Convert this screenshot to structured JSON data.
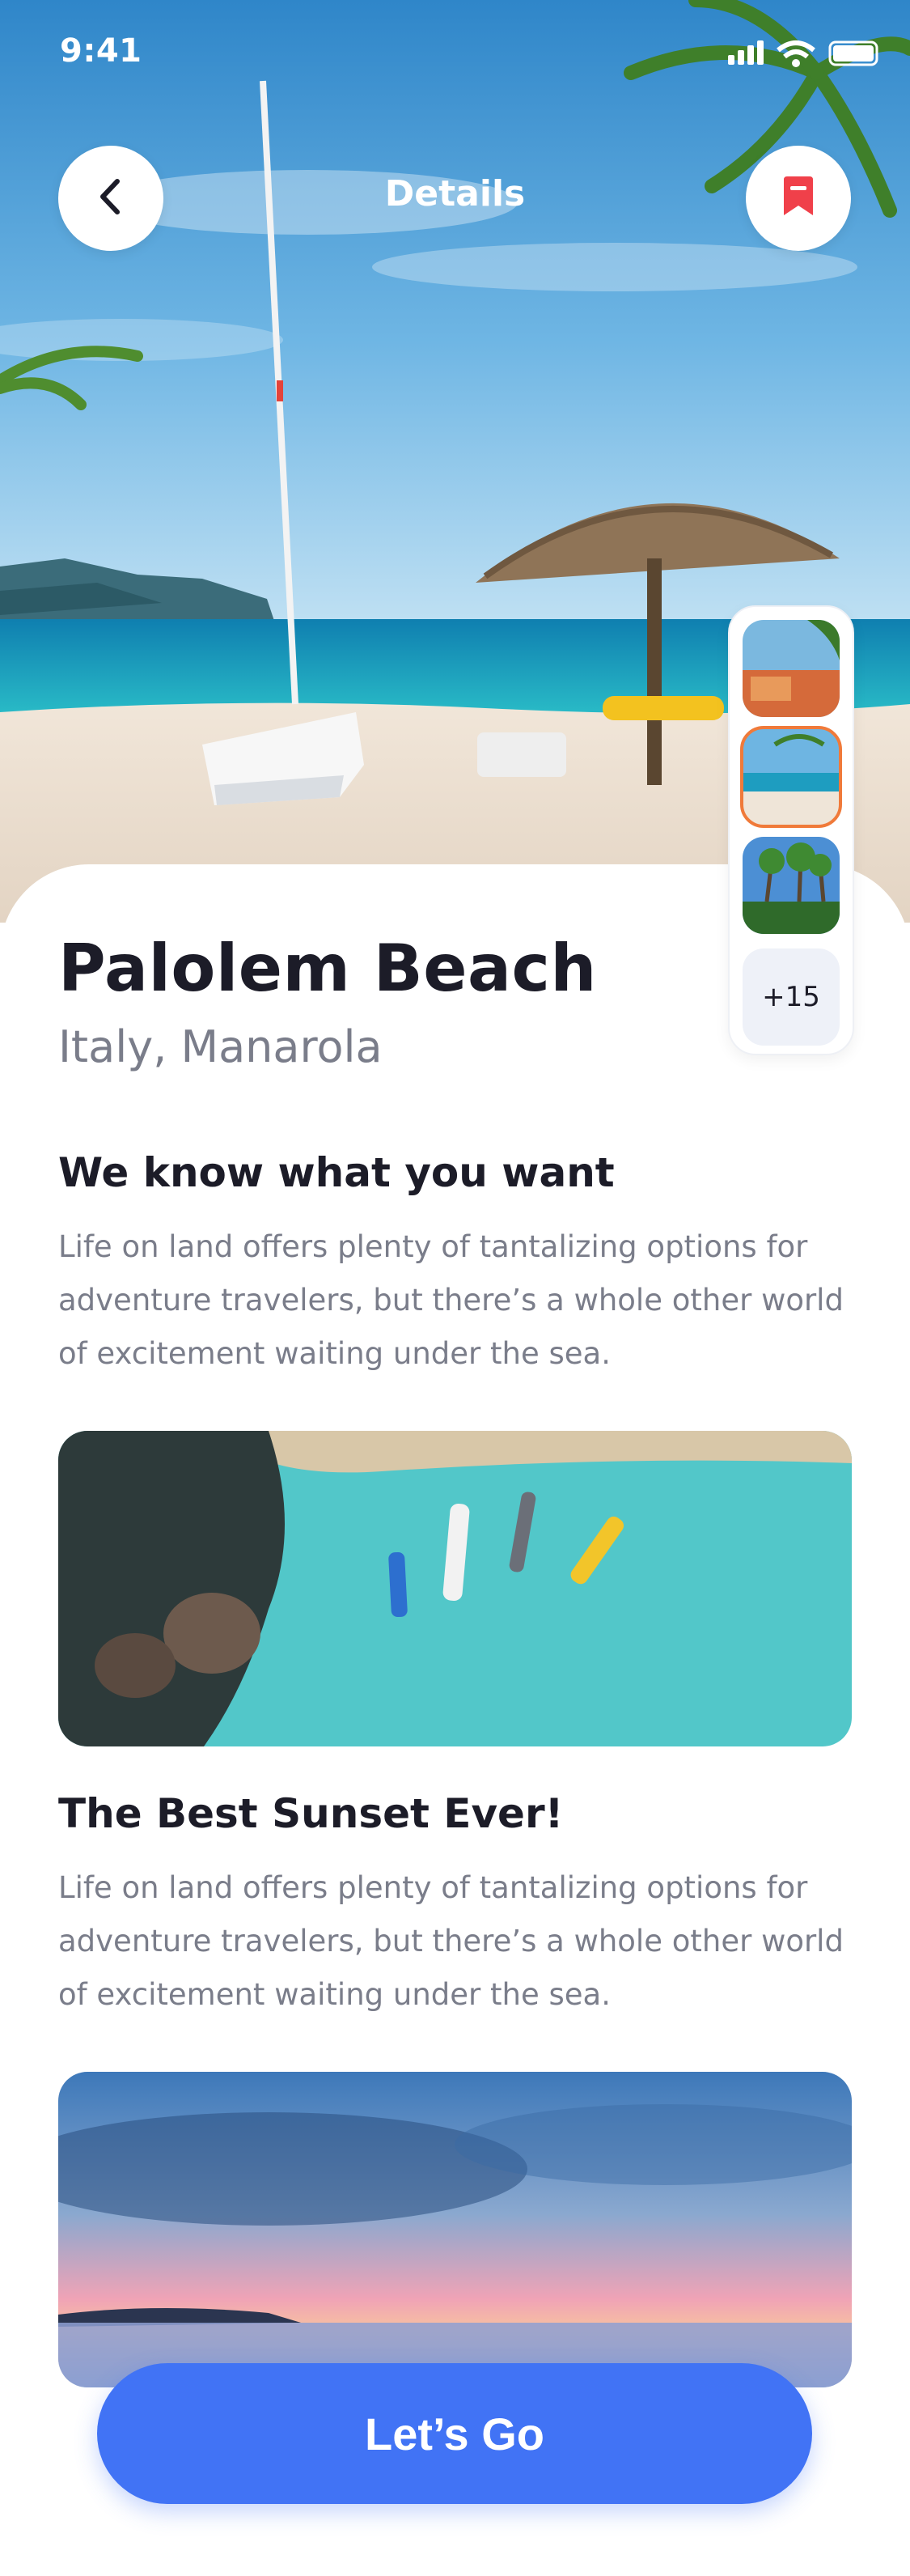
{
  "status_bar": {
    "time": "9:41"
  },
  "header": {
    "title": "Details"
  },
  "icons": {
    "back": "chevron-left-icon",
    "bookmark": "bookmark-icon"
  },
  "colors": {
    "accent": "#4173f5",
    "bookmark": "#f0404a",
    "selected_thumb_border": "#f07a3a",
    "title": "#1c1c28",
    "muted": "#7a7d8a"
  },
  "gallery": {
    "more_label": "+15",
    "selected_index": 1
  },
  "place": {
    "name": "Palolem Beach",
    "location": "Italy, Manarola"
  },
  "sections": [
    {
      "heading": "We know what you want",
      "body": "Life on land offers plenty of tantalizing options for adventure travelers, but there’s a whole other world of excitement waiting under the sea."
    },
    {
      "heading": "The Best Sunset Ever!",
      "body": "Life on land offers plenty of tantalizing options for adventure travelers, but there’s a whole other world of excitement waiting under the sea."
    }
  ],
  "cta": {
    "label": "Let’s Go"
  }
}
